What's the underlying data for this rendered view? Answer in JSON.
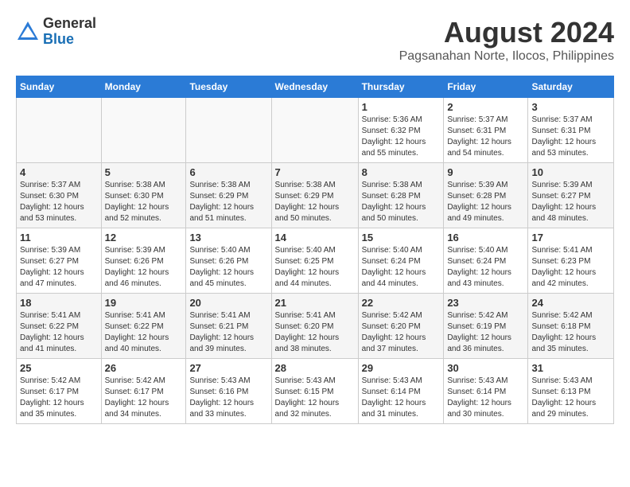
{
  "logo": {
    "general": "General",
    "blue": "Blue"
  },
  "calendar": {
    "title": "August 2024",
    "subtitle": "Pagsanahan Norte, Ilocos, Philippines"
  },
  "headers": [
    "Sunday",
    "Monday",
    "Tuesday",
    "Wednesday",
    "Thursday",
    "Friday",
    "Saturday"
  ],
  "weeks": [
    [
      {
        "day": "",
        "info": ""
      },
      {
        "day": "",
        "info": ""
      },
      {
        "day": "",
        "info": ""
      },
      {
        "day": "",
        "info": ""
      },
      {
        "day": "1",
        "sunrise": "Sunrise: 5:36 AM",
        "sunset": "Sunset: 6:32 PM",
        "daylight": "Daylight: 12 hours and 55 minutes."
      },
      {
        "day": "2",
        "sunrise": "Sunrise: 5:37 AM",
        "sunset": "Sunset: 6:31 PM",
        "daylight": "Daylight: 12 hours and 54 minutes."
      },
      {
        "day": "3",
        "sunrise": "Sunrise: 5:37 AM",
        "sunset": "Sunset: 6:31 PM",
        "daylight": "Daylight: 12 hours and 53 minutes."
      }
    ],
    [
      {
        "day": "4",
        "sunrise": "Sunrise: 5:37 AM",
        "sunset": "Sunset: 6:30 PM",
        "daylight": "Daylight: 12 hours and 53 minutes."
      },
      {
        "day": "5",
        "sunrise": "Sunrise: 5:38 AM",
        "sunset": "Sunset: 6:30 PM",
        "daylight": "Daylight: 12 hours and 52 minutes."
      },
      {
        "day": "6",
        "sunrise": "Sunrise: 5:38 AM",
        "sunset": "Sunset: 6:29 PM",
        "daylight": "Daylight: 12 hours and 51 minutes."
      },
      {
        "day": "7",
        "sunrise": "Sunrise: 5:38 AM",
        "sunset": "Sunset: 6:29 PM",
        "daylight": "Daylight: 12 hours and 50 minutes."
      },
      {
        "day": "8",
        "sunrise": "Sunrise: 5:38 AM",
        "sunset": "Sunset: 6:28 PM",
        "daylight": "Daylight: 12 hours and 50 minutes."
      },
      {
        "day": "9",
        "sunrise": "Sunrise: 5:39 AM",
        "sunset": "Sunset: 6:28 PM",
        "daylight": "Daylight: 12 hours and 49 minutes."
      },
      {
        "day": "10",
        "sunrise": "Sunrise: 5:39 AM",
        "sunset": "Sunset: 6:27 PM",
        "daylight": "Daylight: 12 hours and 48 minutes."
      }
    ],
    [
      {
        "day": "11",
        "sunrise": "Sunrise: 5:39 AM",
        "sunset": "Sunset: 6:27 PM",
        "daylight": "Daylight: 12 hours and 47 minutes."
      },
      {
        "day": "12",
        "sunrise": "Sunrise: 5:39 AM",
        "sunset": "Sunset: 6:26 PM",
        "daylight": "Daylight: 12 hours and 46 minutes."
      },
      {
        "day": "13",
        "sunrise": "Sunrise: 5:40 AM",
        "sunset": "Sunset: 6:26 PM",
        "daylight": "Daylight: 12 hours and 45 minutes."
      },
      {
        "day": "14",
        "sunrise": "Sunrise: 5:40 AM",
        "sunset": "Sunset: 6:25 PM",
        "daylight": "Daylight: 12 hours and 44 minutes."
      },
      {
        "day": "15",
        "sunrise": "Sunrise: 5:40 AM",
        "sunset": "Sunset: 6:24 PM",
        "daylight": "Daylight: 12 hours and 44 minutes."
      },
      {
        "day": "16",
        "sunrise": "Sunrise: 5:40 AM",
        "sunset": "Sunset: 6:24 PM",
        "daylight": "Daylight: 12 hours and 43 minutes."
      },
      {
        "day": "17",
        "sunrise": "Sunrise: 5:41 AM",
        "sunset": "Sunset: 6:23 PM",
        "daylight": "Daylight: 12 hours and 42 minutes."
      }
    ],
    [
      {
        "day": "18",
        "sunrise": "Sunrise: 5:41 AM",
        "sunset": "Sunset: 6:22 PM",
        "daylight": "Daylight: 12 hours and 41 minutes."
      },
      {
        "day": "19",
        "sunrise": "Sunrise: 5:41 AM",
        "sunset": "Sunset: 6:22 PM",
        "daylight": "Daylight: 12 hours and 40 minutes."
      },
      {
        "day": "20",
        "sunrise": "Sunrise: 5:41 AM",
        "sunset": "Sunset: 6:21 PM",
        "daylight": "Daylight: 12 hours and 39 minutes."
      },
      {
        "day": "21",
        "sunrise": "Sunrise: 5:41 AM",
        "sunset": "Sunset: 6:20 PM",
        "daylight": "Daylight: 12 hours and 38 minutes."
      },
      {
        "day": "22",
        "sunrise": "Sunrise: 5:42 AM",
        "sunset": "Sunset: 6:20 PM",
        "daylight": "Daylight: 12 hours and 37 minutes."
      },
      {
        "day": "23",
        "sunrise": "Sunrise: 5:42 AM",
        "sunset": "Sunset: 6:19 PM",
        "daylight": "Daylight: 12 hours and 36 minutes."
      },
      {
        "day": "24",
        "sunrise": "Sunrise: 5:42 AM",
        "sunset": "Sunset: 6:18 PM",
        "daylight": "Daylight: 12 hours and 35 minutes."
      }
    ],
    [
      {
        "day": "25",
        "sunrise": "Sunrise: 5:42 AM",
        "sunset": "Sunset: 6:17 PM",
        "daylight": "Daylight: 12 hours and 35 minutes."
      },
      {
        "day": "26",
        "sunrise": "Sunrise: 5:42 AM",
        "sunset": "Sunset: 6:17 PM",
        "daylight": "Daylight: 12 hours and 34 minutes."
      },
      {
        "day": "27",
        "sunrise": "Sunrise: 5:43 AM",
        "sunset": "Sunset: 6:16 PM",
        "daylight": "Daylight: 12 hours and 33 minutes."
      },
      {
        "day": "28",
        "sunrise": "Sunrise: 5:43 AM",
        "sunset": "Sunset: 6:15 PM",
        "daylight": "Daylight: 12 hours and 32 minutes."
      },
      {
        "day": "29",
        "sunrise": "Sunrise: 5:43 AM",
        "sunset": "Sunset: 6:14 PM",
        "daylight": "Daylight: 12 hours and 31 minutes."
      },
      {
        "day": "30",
        "sunrise": "Sunrise: 5:43 AM",
        "sunset": "Sunset: 6:14 PM",
        "daylight": "Daylight: 12 hours and 30 minutes."
      },
      {
        "day": "31",
        "sunrise": "Sunrise: 5:43 AM",
        "sunset": "Sunset: 6:13 PM",
        "daylight": "Daylight: 12 hours and 29 minutes."
      }
    ]
  ]
}
